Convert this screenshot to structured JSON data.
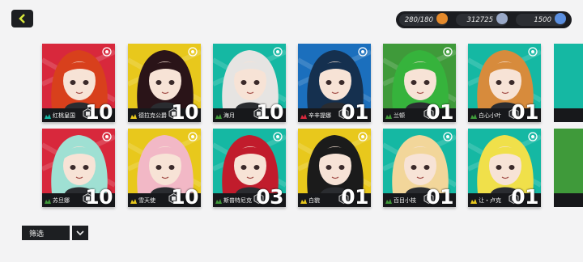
{
  "nav": {
    "back_icon": "chevron-left-icon"
  },
  "resources": {
    "stamina": "280/180",
    "coins": "312725",
    "gems": "1500"
  },
  "filter": {
    "label": "筛选"
  },
  "colors": {
    "accent": "#d7e63c",
    "red": "#d8283c",
    "yellow": "#e8c81c",
    "teal": "#15b8a3",
    "blue": "#1b6fbd",
    "green": "#3f9a3a",
    "dark": "#17181b"
  },
  "characters": [
    {
      "name": "红桃皇国",
      "level": "10",
      "bg": "red",
      "hair": "#d8401c",
      "elem": "teal"
    },
    {
      "name": "德拉克公爵",
      "level": "10",
      "bg": "yellow",
      "hair": "#2a1418",
      "elem": "yellow"
    },
    {
      "name": "海月",
      "level": "10",
      "bg": "teal",
      "hair": "#e6e4e2",
      "elem": "green"
    },
    {
      "name": "辛辛提娜",
      "level": "01",
      "bg": "blue",
      "hair": "#15304f",
      "elem": "red"
    },
    {
      "name": "兰顿",
      "level": "01",
      "bg": "green",
      "hair": "#36b33c",
      "elem": "green"
    },
    {
      "name": "白心小叶",
      "level": "01",
      "bg": "teal",
      "hair": "#d78b3c",
      "elem": "green"
    },
    {
      "name": "苏旦娜",
      "level": "10",
      "bg": "red",
      "hair": "#9fe0d3",
      "elem": "green"
    },
    {
      "name": "雪天使",
      "level": "10",
      "bg": "yellow",
      "hair": "#f2b8c6",
      "elem": "yellow"
    },
    {
      "name": "斯普特尼克",
      "level": "03",
      "bg": "teal",
      "hair": "#c11c2c",
      "elem": "green"
    },
    {
      "name": "白貌",
      "level": "01",
      "bg": "yellow",
      "hair": "#1b1b1b",
      "elem": "yellow"
    },
    {
      "name": "百目小枝",
      "level": "01",
      "bg": "teal",
      "hair": "#f2d69a",
      "elem": "green"
    },
    {
      "name": "让・卢克",
      "level": "01",
      "bg": "teal",
      "hair": "#f0e04a",
      "elem": "yellow"
    }
  ]
}
